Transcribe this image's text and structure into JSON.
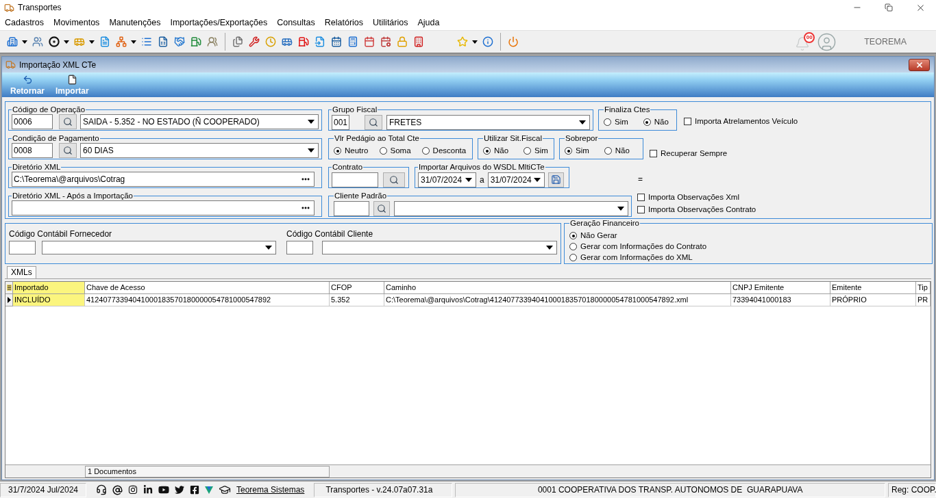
{
  "window": {
    "title": "Transportes"
  },
  "menu": [
    "Cadastros",
    "Movimentos",
    "Manutenções",
    "Importações/Exportações",
    "Consultas",
    "Relatórios",
    "Utilitários",
    "Ajuda"
  ],
  "toolbar": {
    "notification_count": "00",
    "user_name": "TEOREMA"
  },
  "child_window": {
    "title": "Importação XML CTe",
    "actions": [
      {
        "kind": "back",
        "label": "Retornar"
      },
      {
        "kind": "import",
        "label": "Importar"
      }
    ]
  },
  "form": {
    "operation_code": {
      "label": "Código de Operação",
      "code": "0006",
      "value": "SAIDA - 5.352 - NO ESTADO (Ñ COOPERADO)"
    },
    "payment_condition": {
      "label": "Condição de Pagamento",
      "code": "0008",
      "value": "60 DIAS"
    },
    "xml_directory": {
      "label": "Diretório XML",
      "value": "C:\\Teorema\\@arquivos\\Cotrag"
    },
    "xml_directory_after_import": {
      "label": "Diretório XML - Após a Importação"
    },
    "fiscal_group": {
      "label": "Grupo Fiscal",
      "code": "001",
      "value": "FRETES"
    },
    "finalize_ctes": {
      "label": "Finaliza Ctes",
      "options": [
        {
          "label": "Sim",
          "selected": false
        },
        {
          "label": "Não",
          "selected": true
        }
      ]
    },
    "import_vehicle_links": {
      "label": "Importa Atrelamentos Veículo",
      "checked": false
    },
    "toll_value_on_total": {
      "label": "Vlr Pedágio ao Total Cte",
      "options": [
        {
          "label": "Neutro",
          "selected": true
        },
        {
          "label": "Soma",
          "selected": false
        },
        {
          "label": "Desconta",
          "selected": false
        }
      ]
    },
    "use_fiscal_status": {
      "label": "Utilizar Sit.Fiscal",
      "options": [
        {
          "label": "Não",
          "selected": true
        },
        {
          "label": "Sim",
          "selected": false
        }
      ]
    },
    "overwrite": {
      "label": "Sobrepor",
      "options": [
        {
          "label": "Sim",
          "selected": true
        },
        {
          "label": "Não",
          "selected": false
        }
      ]
    },
    "always_recover": {
      "label": "Recuperar Sempre",
      "checked": false
    },
    "contract": {
      "label": "Contrato"
    },
    "wsdl_import": {
      "label": "Importar Arquivos do WSDL MltiCTe",
      "date_from": "31/07/2024",
      "separator": "a",
      "date_to": "31/07/2024"
    },
    "equals_sign": "=",
    "default_client": {
      "label": "Cliente Padrão"
    },
    "import_xml_notes": {
      "label": "Importa Observações Xml",
      "checked": false
    },
    "import_contract_notes": {
      "label": "Importa Observações Contrato",
      "checked": false
    }
  },
  "accounting": {
    "supplier_account": {
      "label": "Código Contábil Fornecedor"
    },
    "client_account": {
      "label": "Código Contábil Cliente"
    },
    "financial_generation": {
      "label": "Geração Financeiro",
      "options": [
        {
          "label": "Não Gerar",
          "selected": true
        },
        {
          "label": "Gerar com Informações do Contrato",
          "selected": false
        },
        {
          "label": "Gerar com Informações do XML",
          "selected": false
        }
      ]
    }
  },
  "tabs": [
    {
      "label": "XMLs",
      "selected": true
    }
  ],
  "grid": {
    "columns": [
      {
        "label": "Importado",
        "highlighted": true
      },
      {
        "label": "Chave de Acesso",
        "highlighted": false
      },
      {
        "label": "CFOP",
        "highlighted": false
      },
      {
        "label": "Caminho",
        "highlighted": false
      },
      {
        "label": "CNPJ Emitente",
        "highlighted": false
      },
      {
        "label": "Emitente",
        "highlighted": false
      },
      {
        "label": "Tip",
        "highlighted": false
      }
    ],
    "rows": [
      {
        "selected": true,
        "cells": [
          "INCLUÍDO",
          "41240773394041000183570180000054781000547892",
          "5.352",
          "C:\\Teorema\\@arquivos\\Cotrag\\41240773394041000183570180000054781000547892.xml",
          "73394041000183",
          "PRÓPRIO",
          "PR"
        ]
      }
    ],
    "footer": "1 Documentos"
  },
  "status_bar": {
    "date": "31/7/2024 Jul/2024",
    "link": "Teorema Sistemas",
    "app_version": "Transportes - v.24.07a07.31a",
    "company": "0001 COOPERATIVA DOS TRANSP. AUTONOMOS DE  GUARAPUAVA",
    "registration": "Reg: COOP."
  }
}
